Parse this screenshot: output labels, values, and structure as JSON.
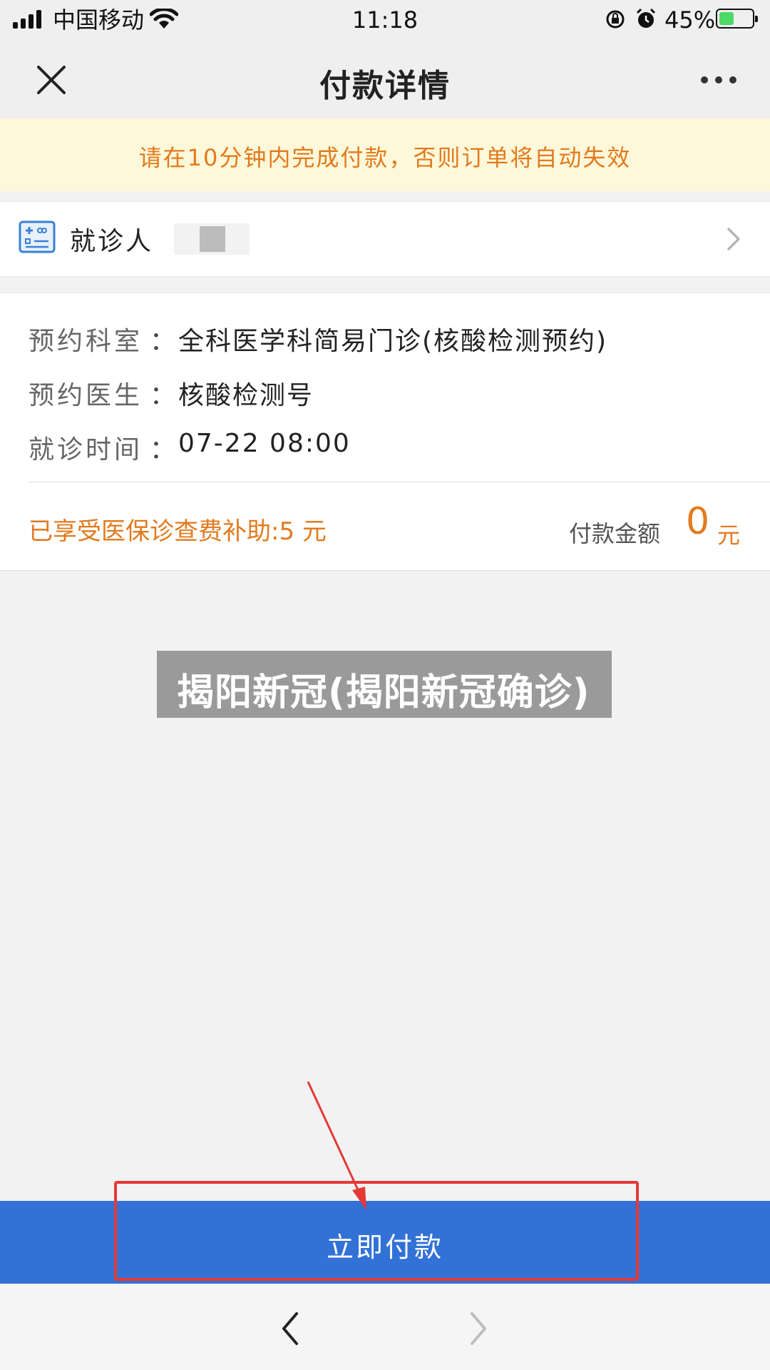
{
  "status_bar": {
    "carrier": "中国移动",
    "time": "11:18",
    "battery": "45%",
    "battery_level": 0.45
  },
  "nav": {
    "title": "付款详情"
  },
  "notice": {
    "text": "请在10分钟内完成付款，否则订单将自动失效"
  },
  "patient": {
    "label": "就诊人"
  },
  "details": {
    "colon": "：",
    "rows": [
      {
        "label": "预约科室",
        "value": "全科医学科简易门诊(核酸检测预约)"
      },
      {
        "label": "预约医生",
        "value": "核酸检测号"
      },
      {
        "label": "就诊时间",
        "value": "07-22 08:00"
      }
    ]
  },
  "subsidy": {
    "text": "已享受医保诊查费补助:5 元"
  },
  "payment": {
    "label": "付款金额",
    "amount": "0",
    "unit": "元"
  },
  "watermark": {
    "text": "揭阳新冠(揭阳新冠确诊)"
  },
  "pay_button": {
    "label": "立即付款"
  },
  "colors": {
    "accent_orange": "#e27a1e",
    "pay_blue": "#3271d6",
    "annotation_red": "#e53935"
  }
}
